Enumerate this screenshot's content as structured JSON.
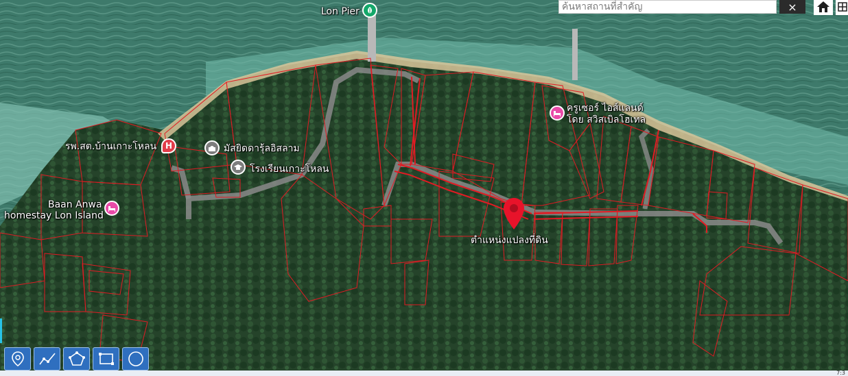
{
  "map": {
    "search": {
      "placeholder": "ค้นหาสถานที่สำคัญ",
      "clear_label": "×"
    },
    "pois": [
      {
        "id": "lon-pier",
        "label": "Lon Pier",
        "icon": "leaf-pin-icon",
        "color": "#14a86a"
      },
      {
        "id": "hospital",
        "label": "รพ.สต.บ้านเกาะโหลน",
        "icon": "hospital-icon",
        "color": "#e23d4a"
      },
      {
        "id": "mosque",
        "label": "มัสยิดดารุ้ลอิสลาม",
        "icon": "mosque-icon",
        "color": "#7d7d7d"
      },
      {
        "id": "school",
        "label": "โรงเรียนเกาะโหลน",
        "icon": "graduation-cap-icon",
        "color": "#7d7d7d"
      },
      {
        "id": "resort",
        "label_line1": "ครูเซอร์ ไอส์แลนด์",
        "label_line2": "โดย สวิสเบิลโฮเทล",
        "icon": "hotel-icon",
        "color": "#e94aa8"
      },
      {
        "id": "homestay",
        "label_line1": "Baan Anwa",
        "label_line2": "homestay Lon Island",
        "icon": "hotel-icon",
        "color": "#e94aa8"
      }
    ],
    "marker": {
      "label": "ตำแหน่งแปลงที่ดิน",
      "icon": "location-pin-icon",
      "color": "#e8132a"
    }
  },
  "toolbar": {
    "tools": [
      "marker-tool-icon",
      "polyline-tool-icon",
      "polygon-tool-icon",
      "rectangle-tool-icon",
      "circle-tool-icon"
    ]
  },
  "taskbar": {
    "clock": "7:3"
  }
}
